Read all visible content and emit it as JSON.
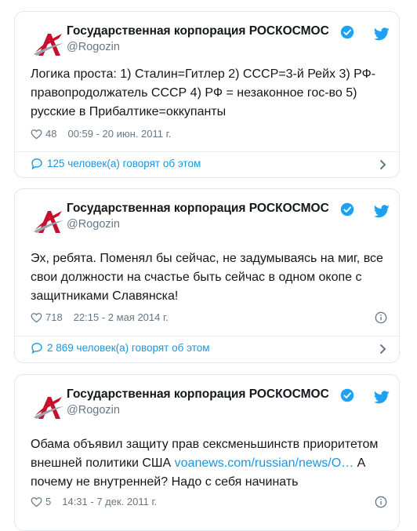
{
  "colors": {
    "accent": "#1b95e0",
    "text": "#14171a",
    "muted": "#657786",
    "border": "#e1e8ed"
  },
  "tweets": [
    {
      "author_name": "Государственная корпорация РОСКОСМОС",
      "handle": "@Rogozin",
      "text": "Логика проста: 1) Сталин=Гитлер 2) СССР=3-й Рейх 3) РФ-правопродолжатель СССР 4) РФ = незаконное гос-во 5) русские в Прибалтике=оккупанты",
      "likes": "48",
      "timestamp": "00:59 - 20 июн. 2011 г.",
      "replies": "125 человек(а) говорят об этом"
    },
    {
      "author_name": "Государственная корпорация РОСКОСМОС",
      "handle": "@Rogozin",
      "text": "Эх, ребята.  Поменял бы сейчас, не задумываясь на миг, все свои должности на счастье быть сейчас в одном окопе с защитниками Славянска!",
      "likes": "718",
      "timestamp": "22:15 - 2 мая 2014 г.",
      "replies": "2 869 человек(а) говорят об этом"
    },
    {
      "author_name": "Государственная корпорация РОСКОСМОС",
      "handle": "@Rogozin",
      "text_before_link": "Обама объявил защиту прав сексменьшинств приоритетом внешней политики США ",
      "link": "voanews.com/russian/news/O…",
      "text_after_link": " А почему не внутренней? Надо с себя начинать",
      "likes": "5",
      "timestamp": "14:31 - 7 дек. 2011 г."
    }
  ]
}
